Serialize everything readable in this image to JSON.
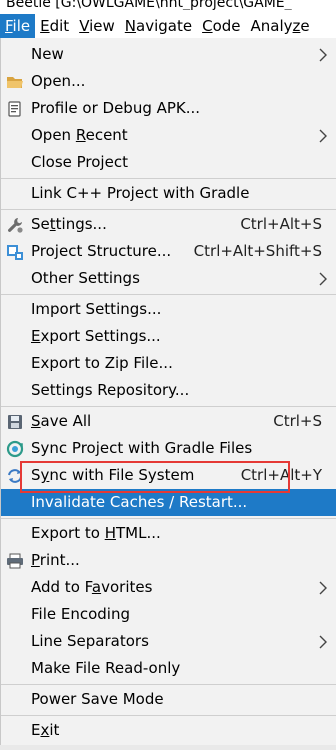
{
  "window_title": "Beetle [G:\\OWLGAME\\hnt_project\\GAME_",
  "menubar": {
    "items": [
      {
        "pre": "",
        "u": "F",
        "post": "ile"
      },
      {
        "pre": "",
        "u": "E",
        "post": "dit"
      },
      {
        "pre": "",
        "u": "V",
        "post": "iew"
      },
      {
        "pre": "",
        "u": "N",
        "post": "avigate"
      },
      {
        "pre": "",
        "u": "C",
        "post": "ode"
      },
      {
        "pre": "Analy",
        "u": "z",
        "post": "e"
      }
    ]
  },
  "file_menu": {
    "new": {
      "pre": "",
      "u": "",
      "post": "New"
    },
    "open": {
      "pre": "Open...",
      "u": "",
      "post": ""
    },
    "profile": {
      "pre": "Profile or Debug APK...",
      "u": "",
      "post": ""
    },
    "open_recent": {
      "pre": "Open ",
      "u": "R",
      "post": "ecent"
    },
    "close_project": {
      "pre": "Close Project",
      "u": "",
      "post": ""
    },
    "link_cpp": {
      "pre": "Link C++ Project with Gradle",
      "u": "",
      "post": ""
    },
    "settings": {
      "pre": "Se",
      "u": "t",
      "post": "tings...",
      "shortcut": "Ctrl+Alt+S"
    },
    "project_structure": {
      "pre": "Project Structure...",
      "u": "",
      "post": "",
      "shortcut": "Ctrl+Alt+Shift+S"
    },
    "other_settings": {
      "pre": "Other Settings",
      "u": "",
      "post": ""
    },
    "import_settings": {
      "pre": "Import Settings...",
      "u": "",
      "post": ""
    },
    "export_settings": {
      "pre": "",
      "u": "E",
      "post": "xport Settings..."
    },
    "export_zip": {
      "pre": "Export to Zip File...",
      "u": "",
      "post": ""
    },
    "settings_repo": {
      "pre": "Settings Repository...",
      "u": "",
      "post": ""
    },
    "save_all": {
      "pre": "",
      "u": "S",
      "post": "ave All",
      "shortcut": "Ctrl+S"
    },
    "sync_gradle": {
      "pre": "Sync Project with Gradle Files",
      "u": "",
      "post": ""
    },
    "sync_fs": {
      "pre": "S",
      "u": "y",
      "post": "nc with File System",
      "shortcut": "Ctrl+Alt+Y"
    },
    "invalidate": {
      "pre": "Invalidate Caches / Restart...",
      "u": "",
      "post": ""
    },
    "export_html": {
      "pre": "Export to ",
      "u": "H",
      "post": "TML..."
    },
    "print": {
      "pre": "",
      "u": "P",
      "post": "rint..."
    },
    "add_fav": {
      "pre": "Add to F",
      "u": "a",
      "post": "vorites"
    },
    "file_encoding": {
      "pre": "File Encoding",
      "u": "",
      "post": ""
    },
    "line_sep": {
      "pre": "Line Separators",
      "u": "",
      "post": ""
    },
    "make_readonly": {
      "pre": "Make File Read-only",
      "u": "",
      "post": ""
    },
    "power_save": {
      "pre": "Power Save Mode",
      "u": "",
      "post": ""
    },
    "exit": {
      "pre": "E",
      "u": "x",
      "post": "it"
    }
  },
  "colors": {
    "selection": "#1e7ac7",
    "menu_bg": "#f2f2f2",
    "annotation_box": "#e53935"
  }
}
